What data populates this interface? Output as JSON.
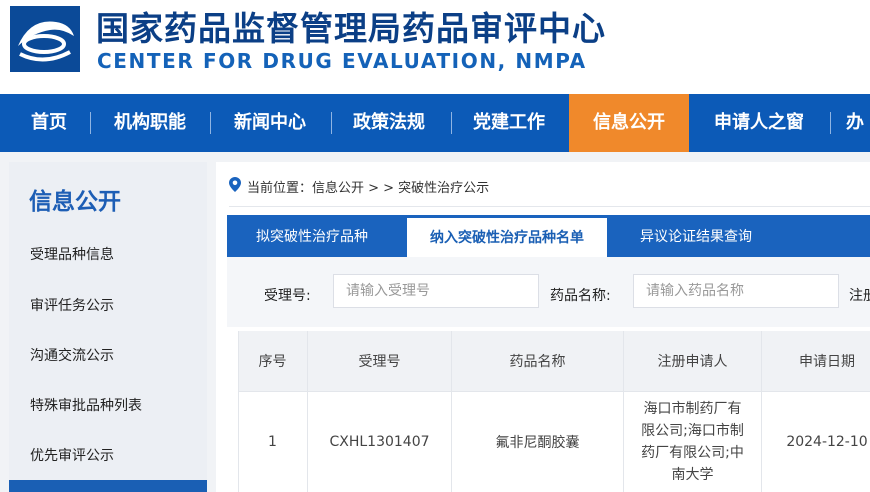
{
  "header": {
    "title_cn": "国家药品监督管理局药品审评中心",
    "title_en": "CENTER FOR DRUG EVALUATION, NMPA"
  },
  "nav": {
    "items": [
      {
        "label": "首页"
      },
      {
        "label": "机构职能"
      },
      {
        "label": "新闻中心"
      },
      {
        "label": "政策法规"
      },
      {
        "label": "党建工作"
      },
      {
        "label": "信息公开",
        "active": true
      },
      {
        "label": "申请人之窗"
      },
      {
        "label": "办"
      }
    ]
  },
  "sidebar": {
    "title": "信息公开",
    "items": [
      {
        "label": "受理品种信息"
      },
      {
        "label": "审评任务公示"
      },
      {
        "label": "沟通交流公示"
      },
      {
        "label": "特殊审批品种列表"
      },
      {
        "label": "优先审评公示"
      }
    ]
  },
  "breadcrumb": {
    "text": "当前位置：信息公开 > > 突破性治疗公示"
  },
  "tabs": [
    {
      "label": "拟突破性治疗品种"
    },
    {
      "label": "纳入突破性治疗品种名单",
      "active": true
    },
    {
      "label": "异议论证结果查询"
    }
  ],
  "filters": {
    "accept_no_label": "受理号:",
    "accept_no_placeholder": "请输入受理号",
    "drug_name_label": "药品名称:",
    "drug_name_placeholder": "请输入药品名称",
    "applicant_label": "注册"
  },
  "table": {
    "headers": [
      "序号",
      "受理号",
      "药品名称",
      "注册申请人",
      "申请日期"
    ],
    "rows": [
      {
        "index": "1",
        "accept_no": "CXHL1301407",
        "drug_name": "氟非尼酮胶囊",
        "applicant": "海口市制药厂有限公司;海口市制药厂有限公司;中南大学",
        "date": "2024-12-10"
      }
    ]
  },
  "colors": {
    "nav_bg": "#0c5ab7",
    "nav_active": "#f0892b",
    "title": "#0b3f86"
  }
}
